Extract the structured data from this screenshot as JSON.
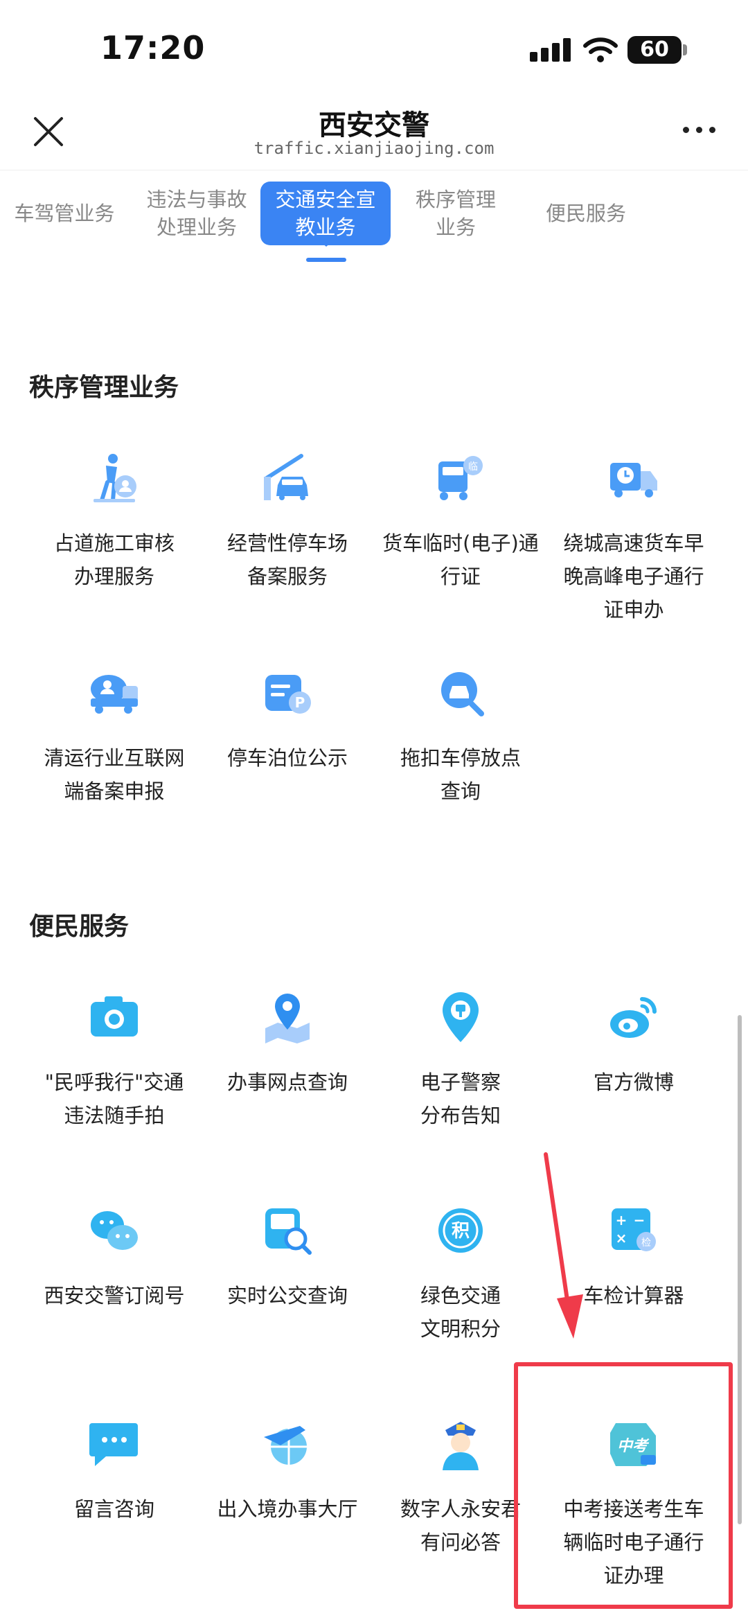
{
  "status": {
    "time": "17:20",
    "battery": "60"
  },
  "nav": {
    "title": "西安交警",
    "subtitle": "traffic.xianjiaojing.com"
  },
  "tabs": [
    {
      "label": "车驾管业务"
    },
    {
      "label": "违法与事故\n处理业务"
    },
    {
      "label": "交通安全宣\n教业务"
    },
    {
      "label": "秩序管理\n业务"
    },
    {
      "label": "便民服务"
    }
  ],
  "sections": {
    "order": {
      "title": "秩序管理业务",
      "items": [
        {
          "label": "占道施工审核\n办理服务",
          "icon": "road-worker-icon"
        },
        {
          "label": "经营性停车场\n备案服务",
          "icon": "parking-barrier-icon"
        },
        {
          "label": "货车临时(电子)通\n行证",
          "icon": "truck-temp-pass-icon"
        },
        {
          "label": "绕城高速货车早\n晚高峰电子通行\n证申办",
          "icon": "truck-clock-icon"
        },
        {
          "label": "清运行业互联网\n端备案申报",
          "icon": "garbage-truck-icon"
        },
        {
          "label": "停车泊位公示",
          "icon": "parking-sign-icon"
        },
        {
          "label": "拖扣车停放点\n查询",
          "icon": "car-search-icon"
        }
      ]
    },
    "convenience": {
      "title": "便民服务",
      "items": [
        {
          "label": "\"民呼我行\"交通\n违法随手拍",
          "icon": "camera-icon"
        },
        {
          "label": "办事网点查询",
          "icon": "map-pin-icon"
        },
        {
          "label": "电子警察\n分布告知",
          "icon": "police-camera-icon"
        },
        {
          "label": "官方微博",
          "icon": "weibo-icon"
        },
        {
          "label": "西安交警订阅号",
          "icon": "wechat-icon"
        },
        {
          "label": "实时公交查询",
          "icon": "bus-search-icon"
        },
        {
          "label": "绿色交通\n文明积分",
          "icon": "points-icon"
        },
        {
          "label": "车检计算器",
          "icon": "calculator-icon"
        },
        {
          "label": "留言咨询",
          "icon": "message-icon"
        },
        {
          "label": "出入境办事大厅",
          "icon": "plane-globe-icon"
        },
        {
          "label": "数字人永安君\n有问必答",
          "icon": "digital-police-icon"
        },
        {
          "label": "中考接送考生车\n辆临时电子通行\n证办理",
          "icon": "exam-badge-icon"
        }
      ]
    }
  },
  "colors": {
    "accent": "#3a84f3",
    "icon": "#4a9cf6",
    "highlight": "#ef3b4a"
  }
}
